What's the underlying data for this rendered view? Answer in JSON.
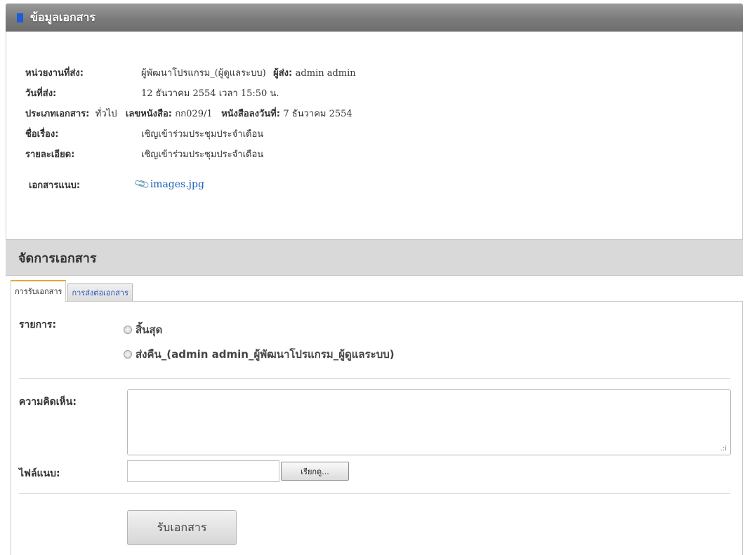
{
  "doc_info": {
    "header_title": "ข้อมูลเอกสาร",
    "sending_unit_label": "หน่วยงานที่ส่ง:",
    "sending_unit_value": "ผู้พัฒนาโปรแกรม_(ผู้ดูแลระบบ)",
    "sender_label": "ผู้ส่ง:",
    "sender_value": "admin admin",
    "send_date_label": "วันที่ส่ง:",
    "send_date_value": "12 ธันวาคม 2554 เวลา 15:50 น.",
    "doc_type_label": "ประเภทเอกสาร:",
    "doc_type_value": "ทั่วไป",
    "doc_no_label": "เลขหนังสือ:",
    "doc_no_value": "กก029/1",
    "doc_date_label": "หนังสือลงวันที่:",
    "doc_date_value": "7 ธันวาคม 2554",
    "subject_label": "ชื่อเรื่อง:",
    "subject_value": "เชิญเข้าร่วมประชุมประจำเดือน",
    "detail_label": "รายละเอียด:",
    "detail_value": "เชิญเข้าร่วมประชุมประจำเดือน",
    "attachment_label": "เอกสารแนบ:",
    "attachment_file": "images.jpg",
    "attachment_icon": "paperclip-icon"
  },
  "manage": {
    "header_title": "จัดการเอกสาร",
    "tabs": [
      {
        "label": "การรับเอกสาร",
        "active": true
      },
      {
        "label": "การส่งต่อเอกสาร",
        "active": false
      }
    ],
    "items_label": "รายการ:",
    "options": [
      {
        "label": "สิ้นสุด",
        "selected": false
      },
      {
        "label": "ส่งคืน_(admin admin_ผู้พัฒนาโปรแกรม_ผู้ดูแลระบบ)",
        "selected": false
      }
    ],
    "comment_label": "ความคิดเห็น:",
    "comment_value": "",
    "attach_label": "ไฟล์แนบ:",
    "file_value": "",
    "browse_label": "เรียกดู...",
    "submit_label": "รับเอกสาร"
  },
  "colors": {
    "header_accent": "#1e5bd6",
    "active_tab_border": "#e8a735",
    "link": "#1a5fb4"
  }
}
